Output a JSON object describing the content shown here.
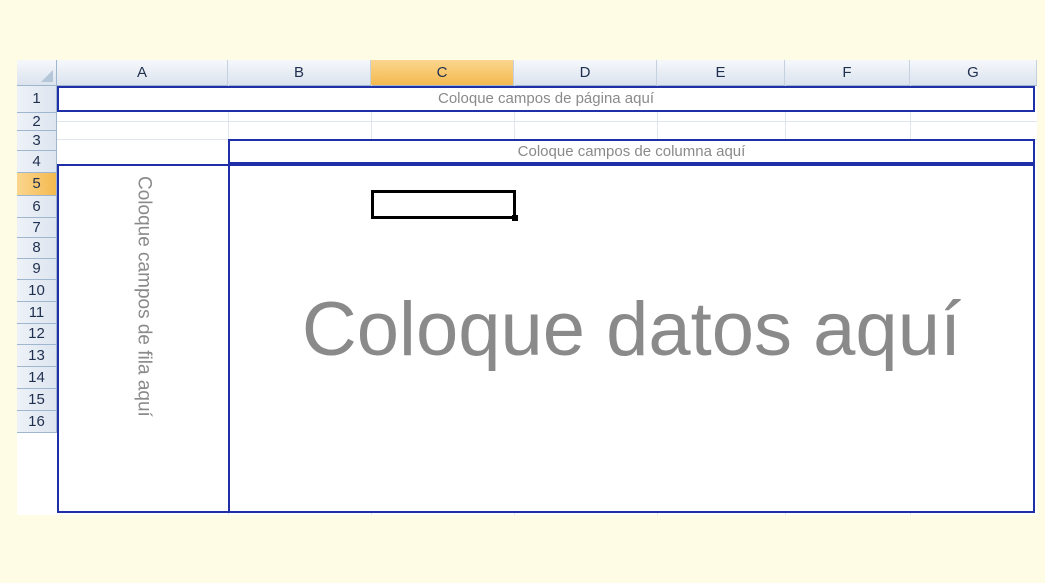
{
  "columns": [
    "A",
    "B",
    "C",
    "D",
    "E",
    "F",
    "G"
  ],
  "selected_column": "C",
  "rows": [
    "1",
    "2",
    "3",
    "4",
    "5",
    "6",
    "7",
    "8",
    "9",
    "10",
    "11",
    "12",
    "13",
    "14",
    "15",
    "16"
  ],
  "selected_row": "5",
  "pivot": {
    "page_fields": "Coloque campos de página aquí",
    "column_fields": "Coloque campos de columna aquí",
    "row_fields": "Coloque campos de fila aquí",
    "data_fields": "Coloque datos aquí"
  },
  "colors": {
    "zone_border": "#1f2fa8",
    "placeholder_text": "#8a8a8a",
    "selected_header": "#f4b94f",
    "background": "#fffce6"
  }
}
